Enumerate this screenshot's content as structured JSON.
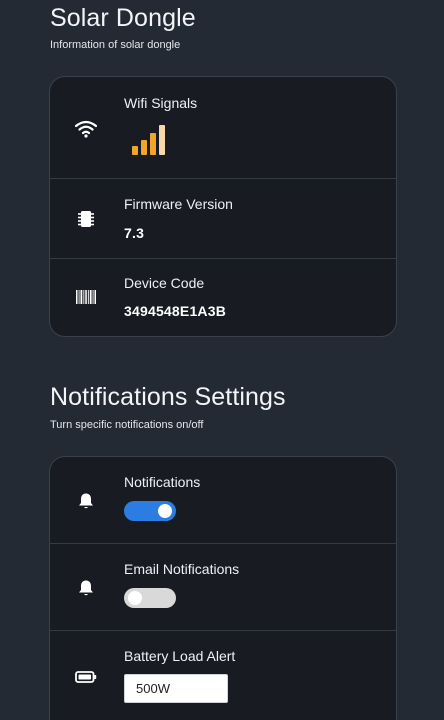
{
  "solar_dongle": {
    "title": "Solar Dongle",
    "subtitle": "Information of solar dongle",
    "rows": [
      {
        "label": "Wifi Signals",
        "icon": "wifi-icon",
        "signal_bars_active": 4,
        "signal_bars_total": 4
      },
      {
        "label": "Firmware Version",
        "icon": "chip-icon",
        "value": "7.3"
      },
      {
        "label": "Device Code",
        "icon": "barcode-icon",
        "value": "3494548E1A3B"
      }
    ]
  },
  "notifications_settings": {
    "title": "Notifications Settings",
    "subtitle": "Turn specific notifications on/off",
    "rows": [
      {
        "label": "Notifications",
        "icon": "bell-icon",
        "enabled": true
      },
      {
        "label": "Email Notifications",
        "icon": "bell-icon",
        "enabled": false
      },
      {
        "label": "Battery Load Alert",
        "icon": "battery-icon",
        "input_value": "500W"
      }
    ]
  },
  "colors": {
    "background": "#232a33",
    "card": "#181c22",
    "toggle_on": "#2c7de1",
    "toggle_off": "#d9d9d9",
    "signal_bar": "#f0a628",
    "signal_bar_light": "#f6d9a6"
  }
}
